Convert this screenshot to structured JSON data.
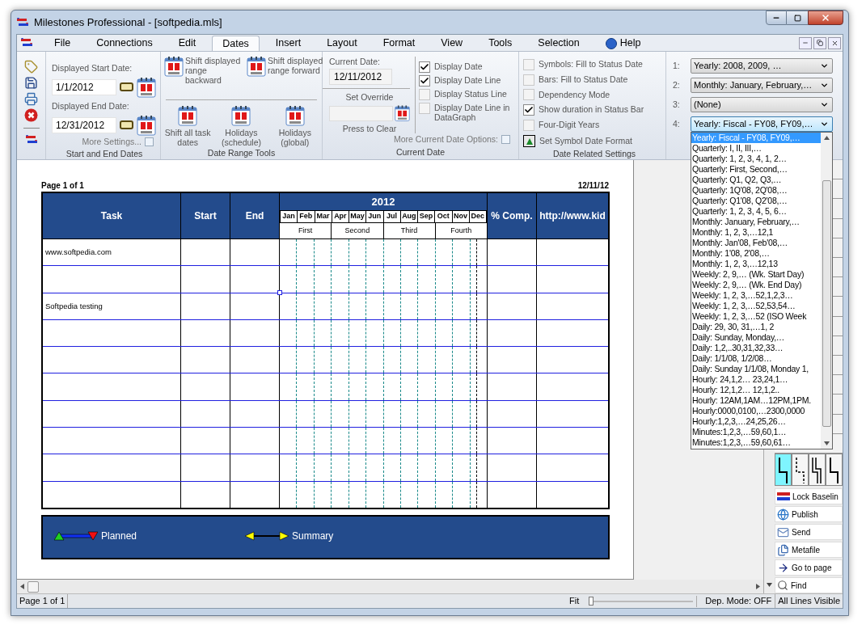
{
  "window": {
    "title": "Milestones Professional - [softpedia.mls]"
  },
  "menu": [
    {
      "label": "File",
      "selected": false
    },
    {
      "label": "Connections",
      "selected": false
    },
    {
      "label": "Edit",
      "selected": false
    },
    {
      "label": "Dates",
      "selected": true
    },
    {
      "label": "Insert",
      "selected": false
    },
    {
      "label": "Layout",
      "selected": false
    },
    {
      "label": "Format",
      "selected": false
    },
    {
      "label": "View",
      "selected": false
    },
    {
      "label": "Tools",
      "selected": false
    },
    {
      "label": "Selection",
      "selected": false
    },
    {
      "label": "Help",
      "selected": false,
      "kind": "help"
    }
  ],
  "start_end": {
    "start_label": "Displayed Start Date:",
    "start_value": "1/1/2012",
    "end_label": "Displayed End Date:",
    "end_value": "12/31/2012",
    "more": "More Settings...",
    "caption": "Start and End Dates"
  },
  "date_range_tools": {
    "top_buttons": [
      "Shift displayed range backward",
      "Shift displayed range forward"
    ],
    "bottom_buttons": [
      "Shift all task dates",
      "Holidays (schedule)",
      "Holidays (global)"
    ],
    "caption": "Date Range Tools"
  },
  "current_date": {
    "label": "Current Date:",
    "value": "12/11/2012",
    "set_override": "Set Override",
    "press_to_clear": "Press to Clear",
    "checkboxes": [
      {
        "label": "Display Date",
        "checked": true
      },
      {
        "label": "Display Date Line",
        "checked": true
      },
      {
        "label": "Display Status Line",
        "checked": false
      },
      {
        "label": "Display Date Line in DataGraph",
        "checked": false
      }
    ],
    "more": "More Current Date Options:",
    "caption": "Current Date"
  },
  "date_related": {
    "checkboxes": [
      {
        "label": "Symbols: Fill to Status Date",
        "checked": false
      },
      {
        "label": "Bars: Fill to Status Date",
        "checked": false
      },
      {
        "label": "Dependency Mode",
        "checked": false
      },
      {
        "label": "Show duration in Status Bar",
        "checked": true
      },
      {
        "label": "Four-Digit Years",
        "checked": false
      }
    ],
    "symbol_format": "Set Symbol Date Format",
    "caption": "Date Related Settings"
  },
  "scales": [
    {
      "number": "1:",
      "value": "Yearly: 2008, 2009, …",
      "expanded": false
    },
    {
      "number": "2:",
      "value": "Monthly: January, February,…",
      "expanded": false
    },
    {
      "number": "3:",
      "value": "(None)",
      "expanded": false
    },
    {
      "number": "4:",
      "value": "Yearly: Fiscal - FY08, FY09,…",
      "expanded": true
    }
  ],
  "scale_options": [
    {
      "label": "Yearly: Fiscal - FY08, FY09,…",
      "selected": true
    },
    {
      "label": "Quarterly: I, II, III,…",
      "selected": false
    },
    {
      "label": "Quarterly: 1, 2, 3, 4, 1, 2…",
      "selected": false
    },
    {
      "label": "Quarterly: First, Second,…",
      "selected": false
    },
    {
      "label": "Quarterly: Q1, Q2, Q3,…",
      "selected": false
    },
    {
      "label": "Quarterly: 1Q'08, 2Q'08,…",
      "selected": false
    },
    {
      "label": "Quarterly: Q1'08, Q2'08,…",
      "selected": false
    },
    {
      "label": "Quarterly: 1, 2, 3, 4, 5, 6…",
      "selected": false
    },
    {
      "label": "Monthly: January, February,…",
      "selected": false
    },
    {
      "label": "Monthly: 1, 2, 3,…12,1",
      "selected": false
    },
    {
      "label": "Monthly: Jan'08, Feb'08,…",
      "selected": false
    },
    {
      "label": "Monthly: 1'08, 2'08,…",
      "selected": false
    },
    {
      "label": "Monthly: 1, 2, 3,…12,13",
      "selected": false
    },
    {
      "label": "Weekly: 2, 9,… (Wk. Start Day)",
      "selected": false
    },
    {
      "label": "Weekly: 2, 9,… (Wk. End Day)",
      "selected": false
    },
    {
      "label": "Weekly: 1, 2, 3,…52,1,2,3…",
      "selected": false
    },
    {
      "label": "Weekly: 1, 2, 3,…52,53,54…",
      "selected": false
    },
    {
      "label": "Weekly: 1, 2, 3,…52 (ISO Week",
      "selected": false
    },
    {
      "label": "Daily: 29, 30, 31,…1, 2",
      "selected": false
    },
    {
      "label": "Daily: Sunday, Monday,…",
      "selected": false
    },
    {
      "label": "Daily: 1,2,..30,31,32,33…",
      "selected": false
    },
    {
      "label": "Daily: 1/1/08, 1/2/08…",
      "selected": false
    },
    {
      "label": "Daily: Sunday 1/1/08, Monday 1,",
      "selected": false
    },
    {
      "label": "Hourly: 24,1,2… 23,24,1…",
      "selected": false
    },
    {
      "label": "Hourly: 12,1,2… 12,1,2..",
      "selected": false
    },
    {
      "label": "Hourly: 12AM,1AM…12PM,1PM.",
      "selected": false
    },
    {
      "label": "Hourly:0000,0100,…2300,0000",
      "selected": false
    },
    {
      "label": "Hourly:1,2,3,…24,25,26…",
      "selected": false
    },
    {
      "label": "Minutes:1,2,3,…59,60,1…",
      "selected": false
    },
    {
      "label": "Minutes:1,2,3,…59,60,61…",
      "selected": false
    }
  ],
  "document": {
    "page_label": "Page 1 of 1",
    "date": "12/11/12",
    "columns": {
      "task": "Task",
      "start": "Start",
      "end": "End",
      "year": "2012",
      "comp": "% Comp.",
      "url": "http://www.kid"
    },
    "months": [
      "Jan",
      "Feb",
      "Mar",
      "Apr",
      "May",
      "Jun",
      "Jul",
      "Aug",
      "Sep",
      "Oct",
      "Nov",
      "Dec"
    ],
    "quarters": [
      "First",
      "Second",
      "Third",
      "Fourth"
    ],
    "rows": [
      {
        "task": "www.softpedia.com"
      },
      {},
      {
        "task": "Softpedia testing",
        "selected": true
      },
      {},
      {},
      {},
      {},
      {},
      {},
      {}
    ],
    "legend": [
      {
        "kind": "planned",
        "label": "Planned"
      },
      {
        "kind": "summary",
        "label": "Summary"
      }
    ]
  },
  "line_styles": [
    {
      "kind": "step",
      "selected": true
    },
    {
      "kind": "dashed",
      "selected": false
    },
    {
      "kind": "double",
      "selected": false
    },
    {
      "kind": "step",
      "selected": false
    }
  ],
  "side_buttons": [
    {
      "kind": "baseline",
      "label": "Lock Baselin"
    },
    {
      "kind": "publish",
      "label": "Publish"
    },
    {
      "kind": "send",
      "label": "Send"
    },
    {
      "kind": "metafile",
      "label": "Metafile"
    },
    {
      "kind": "goto",
      "label": "Go to page"
    },
    {
      "kind": "find",
      "label": "Find"
    }
  ],
  "status_bar": {
    "page": "Page 1 of 1",
    "fit": "Fit",
    "zoom": {
      "level": 0
    },
    "dep_mode": "Dep. Mode: OFF",
    "lines": "All Lines Visible"
  }
}
